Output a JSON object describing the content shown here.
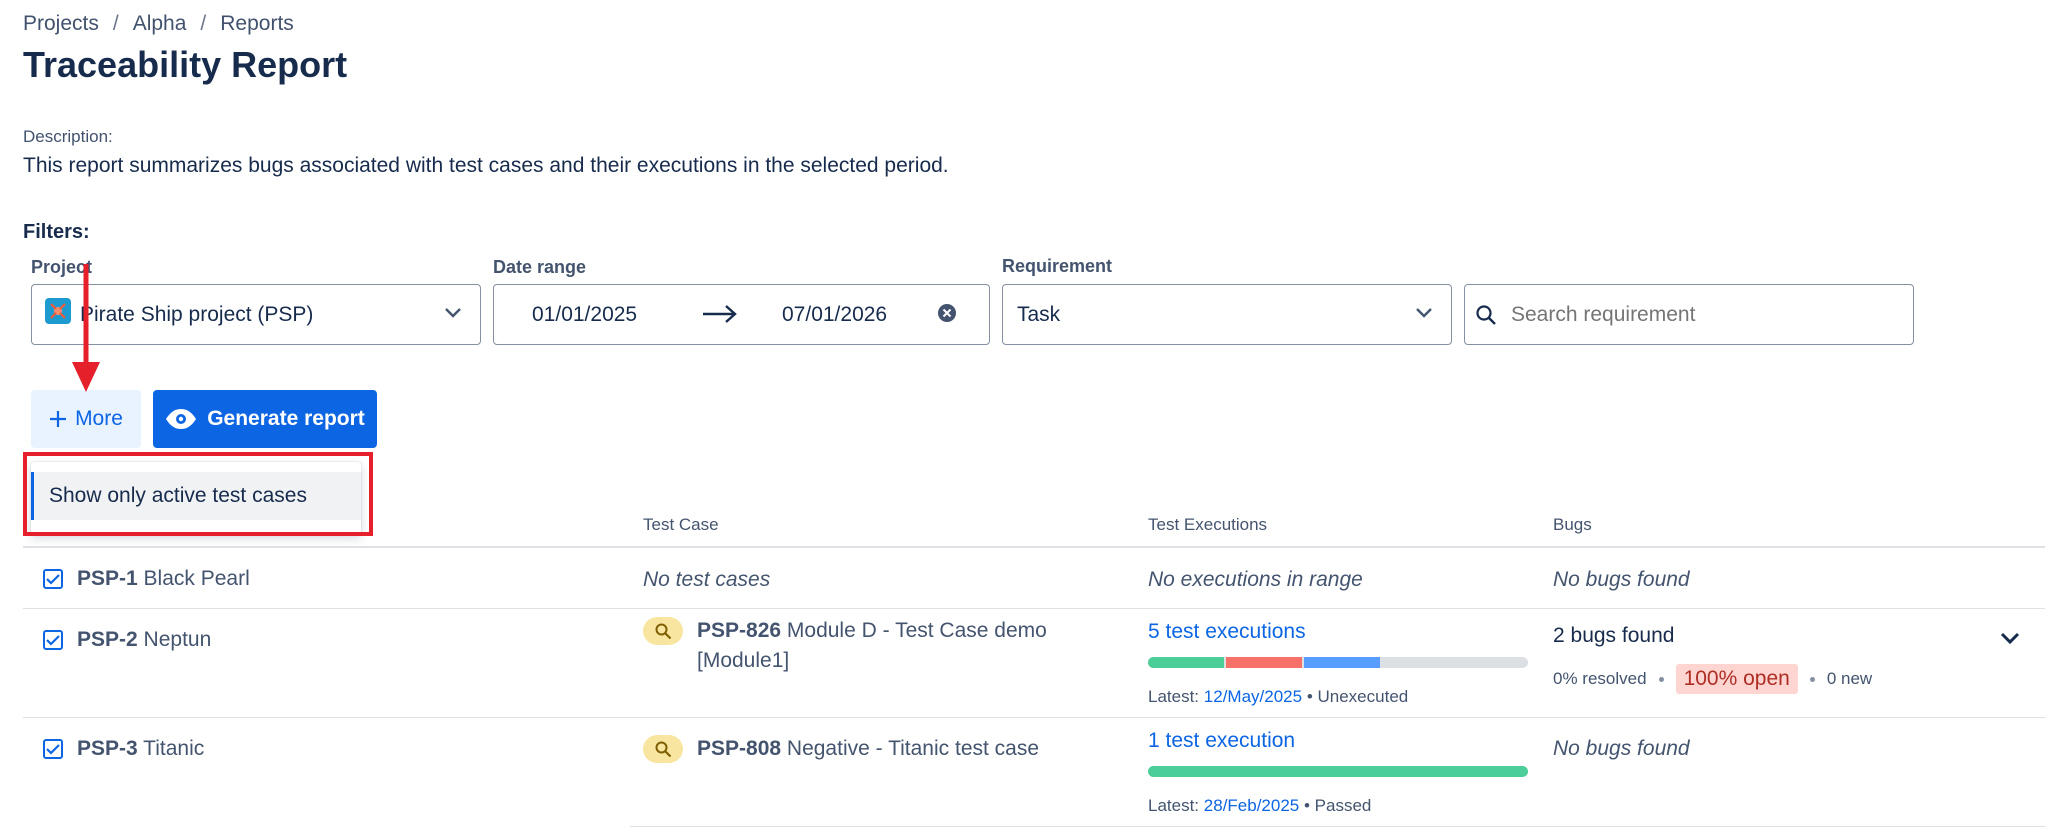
{
  "breadcrumb": [
    "Projects",
    "Alpha",
    "Reports"
  ],
  "page_title": "Traceability Report",
  "description": {
    "label": "Description:",
    "text": "This report summarizes bugs associated with test cases and their executions in the selected period."
  },
  "filters": {
    "label": "Filters:",
    "project": {
      "label": "Project",
      "value": "Pirate Ship project (PSP)"
    },
    "date_range": {
      "label": "Date range",
      "start": "01/01/2025",
      "end": "07/01/2026"
    },
    "requirement": {
      "label": "Requirement",
      "value": "Task"
    },
    "search": {
      "placeholder": "Search requirement"
    }
  },
  "buttons": {
    "more": "More",
    "generate": "Generate report"
  },
  "dropdown": {
    "item": "Show only active test cases"
  },
  "table": {
    "headers": {
      "test_case": "Test Case",
      "test_executions": "Test Executions",
      "bugs": "Bugs"
    },
    "rows": [
      {
        "key": "PSP-1",
        "name": "Black Pearl",
        "test_case": "No test cases",
        "executions": "No executions in range",
        "bugs": "No bugs found"
      },
      {
        "key": "PSP-2",
        "name": "Neptun",
        "tc_key": "PSP-826",
        "tc_name": "Module D - Test Case demo",
        "tc_name2": "[Module1]",
        "executions_link": "5 test executions",
        "latest_label": "Latest:",
        "latest_date": "12/May/2025",
        "latest_status": "Unexecuted",
        "bar": [
          {
            "color": "#4bce97",
            "fraction": 0.2
          },
          {
            "color": "#f87168",
            "fraction": 0.2
          },
          {
            "color": "#579dff",
            "fraction": 0.2
          }
        ],
        "bugs_count": "2 bugs found",
        "resolved": "0% resolved",
        "open": "100% open",
        "new": "0 new"
      },
      {
        "key": "PSP-3",
        "name": "Titanic",
        "tc_key": "PSP-808",
        "tc_name": "Negative - Titanic test case",
        "executions_link": "1 test execution",
        "latest_label": "Latest:",
        "latest_date": "28/Feb/2025",
        "latest_status": "Passed",
        "bar": [
          {
            "color": "#4bce97",
            "fraction": 1.0
          }
        ],
        "bugs": "No bugs found"
      }
    ]
  },
  "colors": {
    "primary": "#0c66e4",
    "annotation": "#e5202a"
  }
}
